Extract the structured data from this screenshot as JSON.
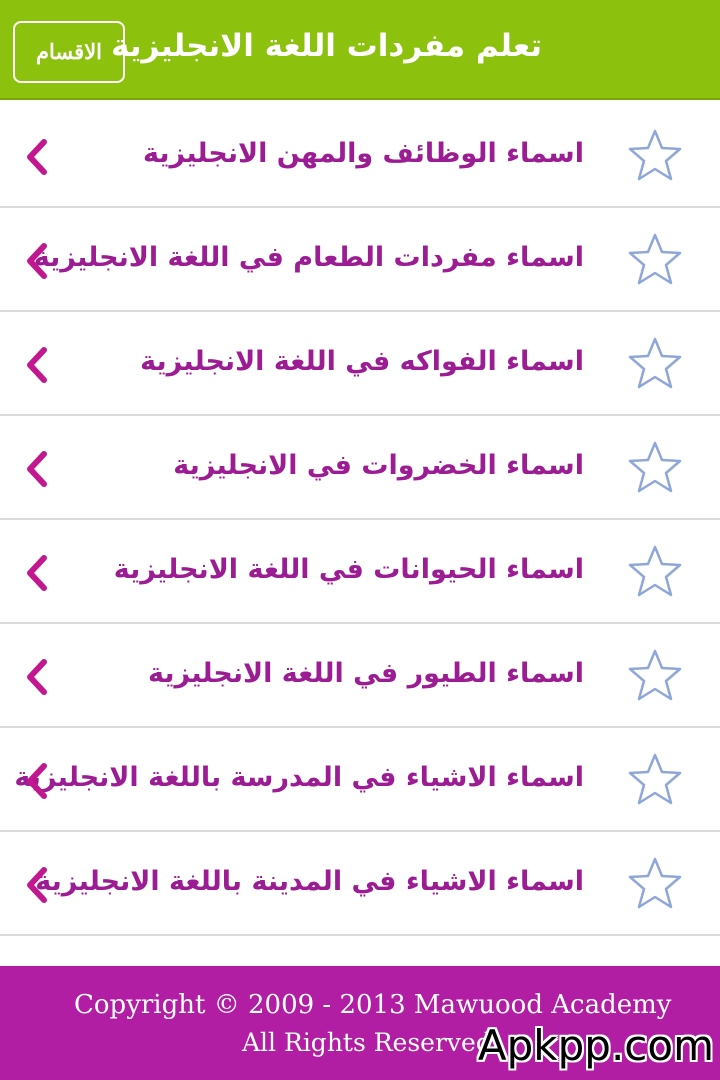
{
  "header": {
    "title": "تعلم مفردات اللغة الانجليزية",
    "sections_button": "الاقسام",
    "color": "#8cc10e"
  },
  "list": {
    "items": [
      {
        "label": "اسماء الوظائف والمهن الانجليزية",
        "icon": "star-outline-icon"
      },
      {
        "label": "اسماء مفردات الطعام في اللغة الانجليزية",
        "icon": "star-outline-icon"
      },
      {
        "label": "اسماء الفواكه في اللغة الانجليزية",
        "icon": "star-outline-icon"
      },
      {
        "label": "اسماء الخضروات في الانجليزية",
        "icon": "star-outline-icon"
      },
      {
        "label": "اسماء الحيوانات في اللغة الانجليزية",
        "icon": "star-outline-icon"
      },
      {
        "label": "اسماء الطيور في اللغة الانجليزية",
        "icon": "star-outline-icon"
      },
      {
        "label": "اسماء الاشياء في المدرسة باللغة الانجليزية",
        "icon": "star-outline-icon"
      },
      {
        "label": "اسماء الاشياء في المدينة باللغة الانجليزية",
        "icon": "star-outline-icon"
      }
    ],
    "label_color": "#9b1c93",
    "chevron_color": "#c2188f",
    "star_color": "#8fa6d8"
  },
  "footer": {
    "copyright": "Copyright © 2009 - 2013 Mawuood Academy",
    "rights": "All Rights Reserved",
    "color": "#b21ea3"
  },
  "watermark": {
    "text": "Apkpp.com"
  }
}
